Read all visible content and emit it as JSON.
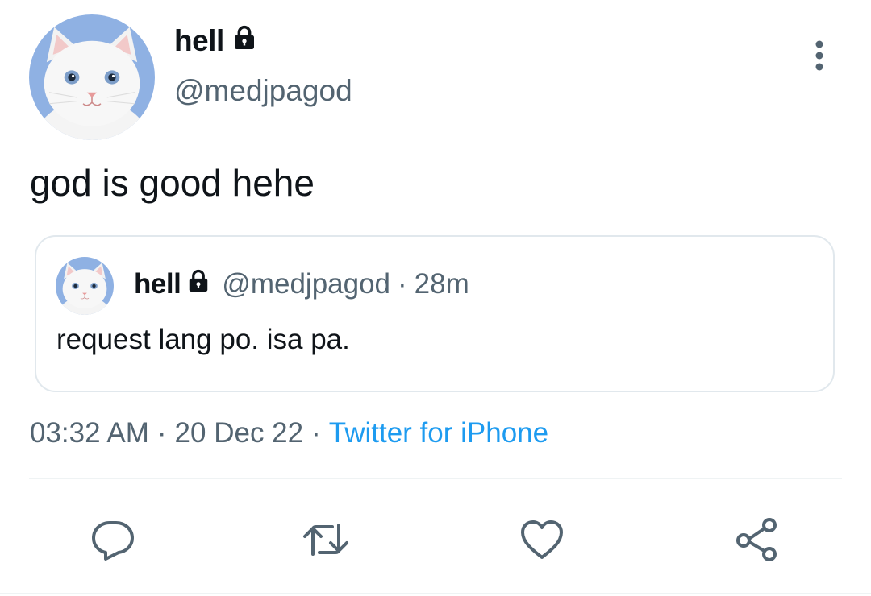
{
  "tweet": {
    "author": {
      "display_name": "hell",
      "handle": "@medjpagod",
      "protected_icon": "lock-icon",
      "avatar": "white-cat-avatar"
    },
    "text": "god is good hehe",
    "more_icon": "more-vertical-icon",
    "quoted": {
      "display_name": "hell",
      "handle": "@medjpagod",
      "separator": "·",
      "time": "28m",
      "text": "request lang po. isa pa."
    },
    "meta": {
      "time": "03:32 AM",
      "separator": "·",
      "date": "20 Dec 22",
      "source": "Twitter for iPhone"
    },
    "actions": [
      {
        "name": "reply",
        "icon": "reply-icon"
      },
      {
        "name": "retweet",
        "icon": "retweet-icon"
      },
      {
        "name": "like",
        "icon": "heart-icon"
      },
      {
        "name": "share",
        "icon": "share-icon"
      }
    ]
  },
  "colors": {
    "text_primary": "#0f1419",
    "text_secondary": "#536471",
    "link": "#1d9bf0",
    "border": "#e1e8ed",
    "avatar_bg": "#8fb1e3"
  }
}
